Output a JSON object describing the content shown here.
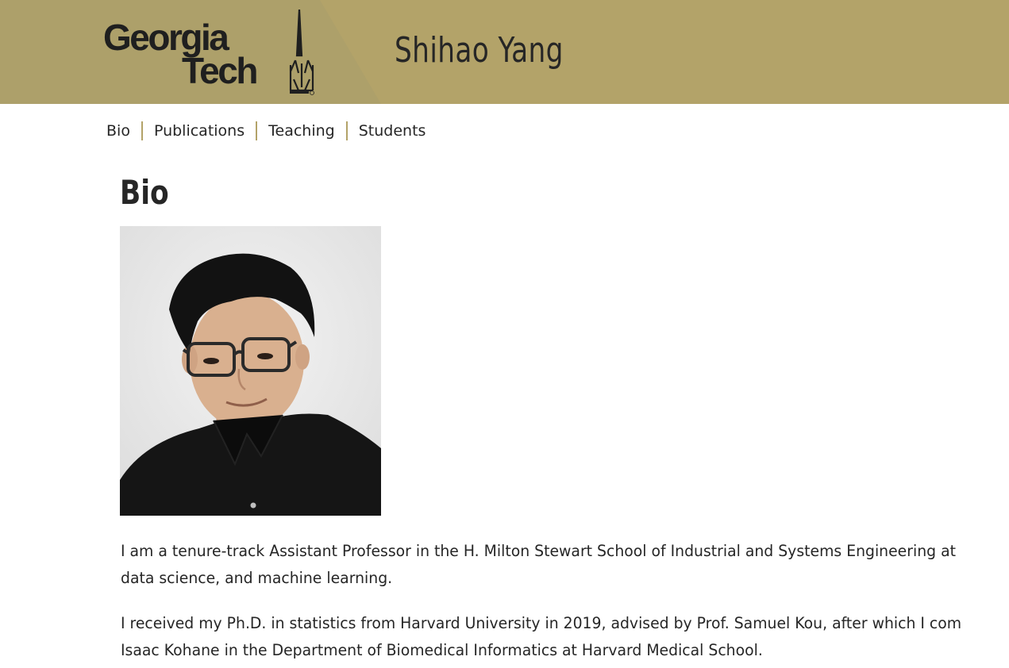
{
  "header": {
    "logo": {
      "line1": "Georgia",
      "line2": "Tech",
      "alt": "Georgia Tech"
    },
    "site_name": "Shihao Yang"
  },
  "nav": {
    "items": [
      {
        "label": "Bio"
      },
      {
        "label": "Publications"
      },
      {
        "label": "Teaching"
      },
      {
        "label": "Students"
      }
    ]
  },
  "main": {
    "title": "Bio",
    "paragraphs": [
      {
        "line1": "I am a tenure-track Assistant Professor in the H. Milton Stewart School of Industrial and Systems Engineering at",
        "line2": "data science, and machine learning."
      },
      {
        "line1": "I received my Ph.D. in statistics from Harvard University in 2019, advised by Prof. Samuel Kou, after which I com",
        "line2": "Isaac Kohane in the Department of Biomedical Informatics at Harvard Medical School."
      }
    ]
  },
  "colors": {
    "header_gold": "#B3A369",
    "header_dark_gold": "#ADA06A",
    "text": "#262626",
    "nav_separator": "#B3A369"
  }
}
